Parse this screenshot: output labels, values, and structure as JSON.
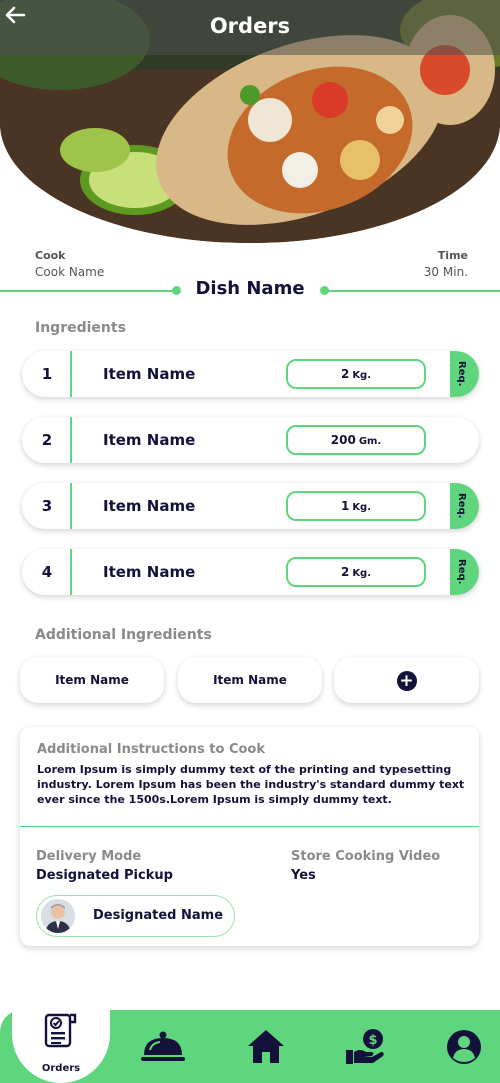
{
  "header": {
    "title": "Orders"
  },
  "meta": {
    "cook_label": "Cook",
    "cook_value": "Cook Name",
    "time_label": "Time",
    "time_value": "30 Min."
  },
  "dish": {
    "name": "Dish Name"
  },
  "ingredients": {
    "label": "Ingredients",
    "items": [
      {
        "num": "1",
        "name": "Item Name",
        "qty": "2",
        "unit": "Kg.",
        "req": "Req."
      },
      {
        "num": "2",
        "name": "Item Name",
        "qty": "200",
        "unit": "Gm.",
        "req": ""
      },
      {
        "num": "3",
        "name": "Item Name",
        "qty": "1",
        "unit": "Kg.",
        "req": "Req."
      },
      {
        "num": "4",
        "name": "Item Name",
        "qty": "2",
        "unit": "Kg.",
        "req": "Req."
      }
    ]
  },
  "additional": {
    "label": "Additional Ingredients",
    "chips": [
      "Item Name",
      "Item Name"
    ],
    "add_icon": "plus-circle-icon"
  },
  "instructions": {
    "label": "Additional Instructions to Cook",
    "text": "Lorem Ipsum is simply dummy text of the printing and typesetting industry. Lorem Ipsum has been the industry's standard dummy text ever since the 1500s.Lorem Ipsum is simply dummy text."
  },
  "delivery": {
    "mode_label": "Delivery Mode",
    "mode_value": "Designated Pickup",
    "video_label": "Store Cooking Video",
    "video_value": "Yes",
    "person_name": "Designated Name"
  },
  "nav": {
    "active_label": "Orders",
    "icons": [
      "orders-icon",
      "cloche-icon",
      "home-icon",
      "money-hand-icon",
      "user-icon"
    ]
  },
  "colors": {
    "accent": "#5fd67d",
    "text": "#14123a",
    "muted": "#8a8a8a"
  }
}
